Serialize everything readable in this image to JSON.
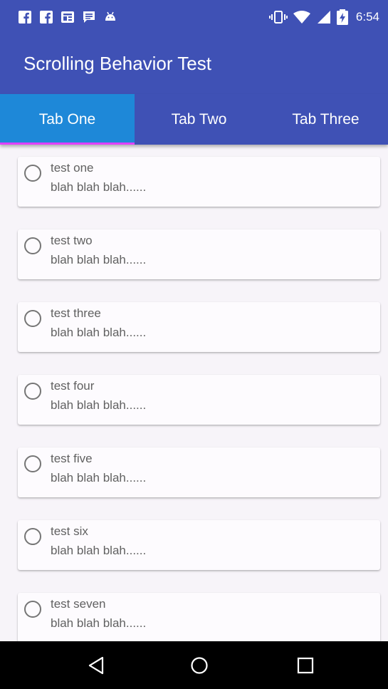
{
  "status_bar": {
    "time": "6:54",
    "left_icons": [
      "facebook-icon",
      "facebook-icon",
      "news-icon",
      "message-icon",
      "android-icon"
    ],
    "right_icons": [
      "vibrate-icon",
      "wifi-icon",
      "signal-icon",
      "battery-icon"
    ]
  },
  "app_bar": {
    "title": "Scrolling Behavior Test"
  },
  "tabs": [
    {
      "label": "Tab One",
      "active": true
    },
    {
      "label": "Tab Two",
      "active": false
    },
    {
      "label": "Tab Three",
      "active": false
    }
  ],
  "items": [
    {
      "title": "test one",
      "subtitle": "blah blah blah......",
      "checked": false
    },
    {
      "title": "test two",
      "subtitle": "blah blah blah......",
      "checked": false
    },
    {
      "title": "test three",
      "subtitle": "blah blah blah......",
      "checked": false
    },
    {
      "title": "test four",
      "subtitle": "blah blah blah......",
      "checked": false
    },
    {
      "title": "test five",
      "subtitle": "blah blah blah......",
      "checked": false
    },
    {
      "title": "test six",
      "subtitle": "blah blah blah......",
      "checked": false
    },
    {
      "title": "test seven",
      "subtitle": "blah blah blah......",
      "checked": false
    }
  ],
  "nav_bar": {
    "buttons": [
      "back-icon",
      "home-icon",
      "recents-icon"
    ]
  },
  "colors": {
    "primary": "#3f51b5",
    "active_tab": "#1e88d8",
    "tab_indicator": "#e040fb",
    "background": "#f7f4f9"
  }
}
